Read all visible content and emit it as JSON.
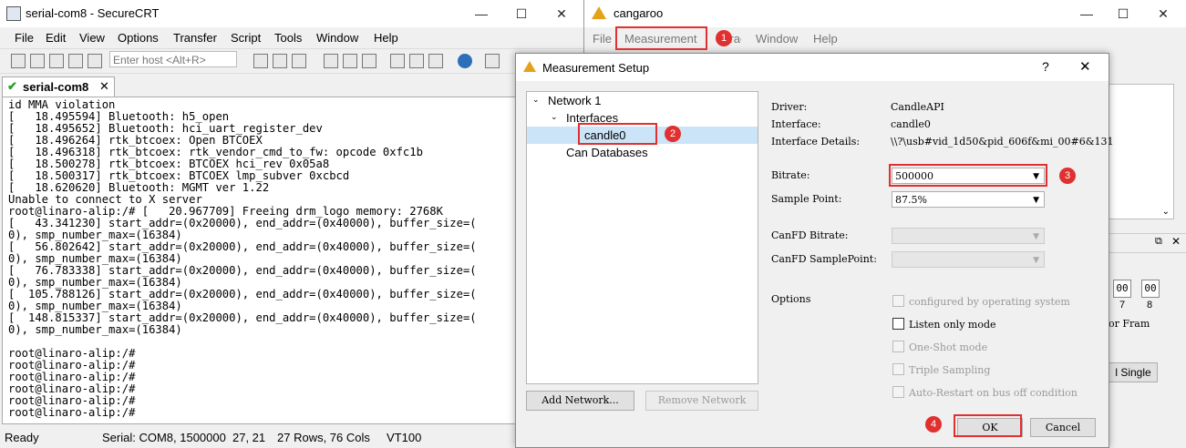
{
  "securecrt": {
    "window_title": "serial-com8 - SecureCRT",
    "menu": [
      "File",
      "Edit",
      "View",
      "Options",
      "Transfer",
      "Script",
      "Tools",
      "Window",
      "Help"
    ],
    "host_placeholder": "Enter host <Alt+R>",
    "tab_label": "serial-com8",
    "terminal_text": "id MMA violation\n[   18.495594] Bluetooth: h5_open\n[   18.495652] Bluetooth: hci_uart_register_dev\n[   18.496264] rtk_btcoex: Open BTCOEX\n[   18.496318] rtk_btcoex: rtk_vendor_cmd_to_fw: opcode 0xfc1b\n[   18.500278] rtk_btcoex: BTCOEX hci_rev 0x05a8\n[   18.500317] rtk_btcoex: BTCOEX lmp_subver 0xcbcd\n[   18.620620] Bluetooth: MGMT ver 1.22\nUnable to connect to X server\nroot@linaro-alip:/# [   20.967709] Freeing drm_logo memory: 2768K\n[   43.341230] start_addr=(0x20000), end_addr=(0x40000), buffer_size=(\n0), smp_number_max=(16384)\n[   56.802642] start_addr=(0x20000), end_addr=(0x40000), buffer_size=(\n0), smp_number_max=(16384)\n[   76.783338] start_addr=(0x20000), end_addr=(0x40000), buffer_size=(\n0), smp_number_max=(16384)\n[  105.788126] start_addr=(0x20000), end_addr=(0x40000), buffer_size=(\n0), smp_number_max=(16384)\n[  148.815337] start_addr=(0x20000), end_addr=(0x40000), buffer_size=(\n0), smp_number_max=(16384)\n\nroot@linaro-alip:/#\nroot@linaro-alip:/#\nroot@linaro-alip:/#\nroot@linaro-alip:/#\nroot@linaro-alip:/#\nroot@linaro-alip:/#",
    "status": {
      "ready": "Ready",
      "serial": "Serial: COM8, 1500000",
      "cursor": "27,  21",
      "size": "27 Rows, 76 Cols",
      "emulation": "VT100"
    }
  },
  "cangaroo": {
    "window_title": "cangaroo",
    "menu": [
      "File",
      "Measurement",
      "Trace",
      "Window",
      "Help"
    ],
    "digits": [
      "00",
      "00"
    ],
    "digit_labels": [
      "7",
      "8"
    ],
    "partial_text": "or Fram",
    "single_button": "l Single"
  },
  "dialog": {
    "title": "Measurement Setup",
    "help": "?",
    "tree": {
      "network": "Network 1",
      "interfaces": "Interfaces",
      "interface_item": "candle0",
      "can_databases": "Can Databases"
    },
    "add_network": "Add Network...",
    "remove_network": "Remove Network",
    "driver_label": "Driver:",
    "driver_value": "CandleAPI",
    "interface_label": "Interface:",
    "interface_value": "candle0",
    "details_label": "Interface Details:",
    "details_value": "\\\\?\\usb#vid_1d50&pid_606f&mi_00#6&131",
    "bitrate_label": "Bitrate:",
    "bitrate_value": "500000",
    "sample_point_label": "Sample Point:",
    "sample_point_value": "87.5%",
    "canfd_bitrate_label": "CanFD Bitrate:",
    "canfd_samplepoint_label": "CanFD SamplePoint:",
    "options_label": "Options",
    "options": {
      "configured": "configured by operating system",
      "listen": "Listen only mode",
      "oneshot": "One-Shot mode",
      "triple": "Triple Sampling",
      "autorestart": "Auto-Restart on bus off condition"
    },
    "ok": "OK",
    "cancel": "Cancel"
  },
  "markers": [
    "1",
    "2",
    "3",
    "4"
  ],
  "colors": {
    "annotation": "#e0302f",
    "selection": "#cce4f7"
  }
}
